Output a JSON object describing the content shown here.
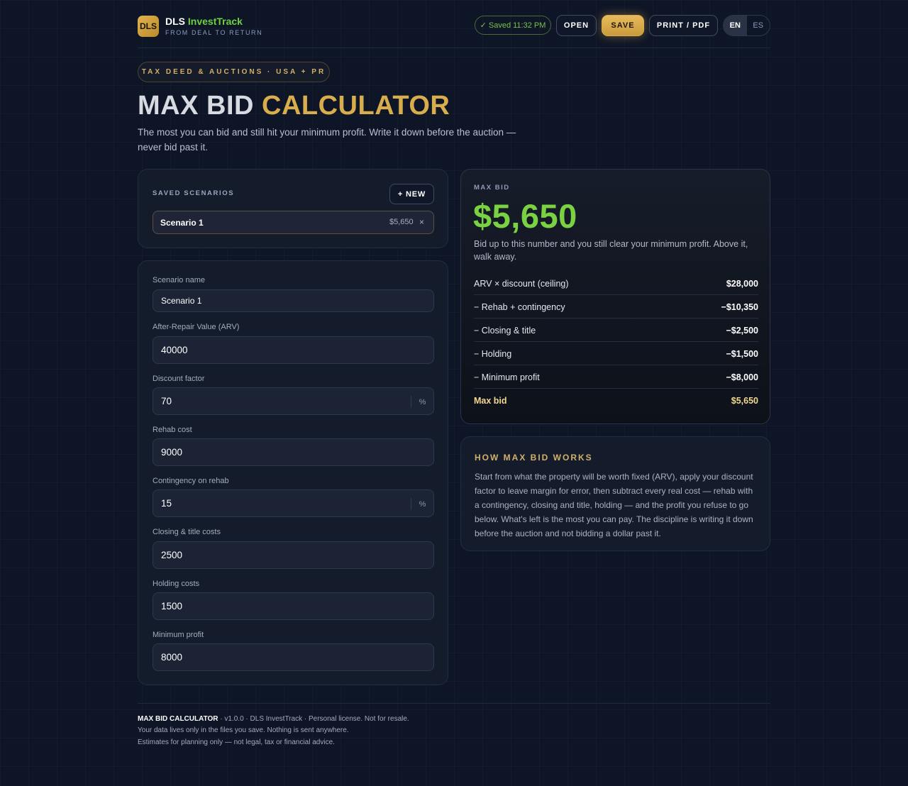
{
  "header": {
    "logo_text": "DLS",
    "brand_prefix": "DLS",
    "brand_accent": "InvestTrack",
    "tagline": "FROM DEAL TO RETURN",
    "saved_status": "✓ Saved 11:32 PM",
    "open_label": "OPEN",
    "save_label": "SAVE",
    "print_label": "PRINT / PDF",
    "lang_en": "EN",
    "lang_es": "ES",
    "active_lang": "EN"
  },
  "hero": {
    "tag": "TAX DEED & AUCTIONS · USA + PR",
    "title_part1": "MAX BID",
    "title_part2": "CALCULATOR",
    "subtitle": "The most you can bid and still hit your minimum profit. Write it down before the auction — never bid past it."
  },
  "scenarios": {
    "label": "SAVED SCENARIOS",
    "new_label": "+ NEW",
    "items": [
      {
        "name": "Scenario 1",
        "value": "$5,650",
        "remove": "×"
      }
    ]
  },
  "form": {
    "fields": [
      {
        "label": "Scenario name",
        "value": "Scenario 1"
      },
      {
        "label": "After-Repair Value (ARV)",
        "value": "40000"
      },
      {
        "label": "Discount factor",
        "value": "70",
        "suffix": "%"
      },
      {
        "label": "Rehab cost",
        "value": "9000"
      },
      {
        "label": "Contingency on rehab",
        "value": "15",
        "suffix": "%"
      },
      {
        "label": "Closing & title costs",
        "value": "2500"
      },
      {
        "label": "Holding costs",
        "value": "1500"
      },
      {
        "label": "Minimum profit",
        "value": "8000"
      }
    ]
  },
  "result": {
    "label": "MAX BID",
    "value": "$5,650",
    "description": "Bid up to this number and you still clear your minimum profit. Above it, walk away.",
    "rows": [
      {
        "label": "ARV × discount (ceiling)",
        "value": "$28,000"
      },
      {
        "label": "− Rehab + contingency",
        "value": "−$10,350"
      },
      {
        "label": "− Closing & title",
        "value": "−$2,500"
      },
      {
        "label": "− Holding",
        "value": "−$1,500"
      },
      {
        "label": "− Minimum profit",
        "value": "−$8,000"
      },
      {
        "label": "Max bid",
        "value": "$5,650"
      }
    ]
  },
  "how": {
    "title": "HOW MAX BID WORKS",
    "body": "Start from what the property will be worth fixed (ARV), apply your discount factor to leave margin for error, then subtract every real cost — rehab with a contingency, closing and title, holding — and the profit you refuse to go below. What's left is the most you can pay. The discipline is writing it down before the auction and not bidding a dollar past it."
  },
  "footer": {
    "app_name": "MAX BID CALCULATOR",
    "line1_rest": " · v1.0.0 · DLS InvestTrack · Personal license. Not for resale.",
    "line2": "Your data lives only in the files you save. Nothing is sent anywhere.",
    "line3": "Estimates for planning only — not legal, tax or financial advice."
  },
  "colors": {
    "accent_gold": "#d8ad4c",
    "accent_green": "#7ad142",
    "background": "#0e1526"
  }
}
